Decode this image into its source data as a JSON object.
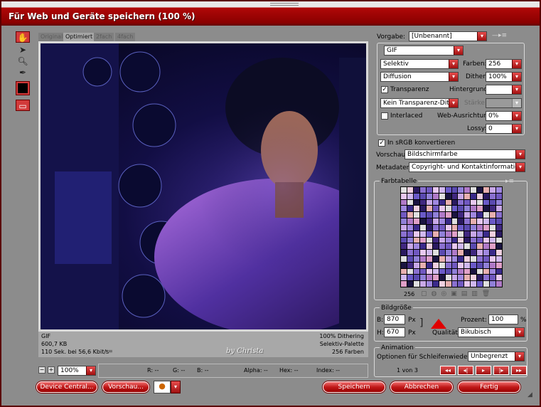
{
  "window": {
    "title": "Für Web und Geräte speichern (100 %)"
  },
  "tabs": [
    "Original",
    "Optimiert",
    "2fach",
    "4fach"
  ],
  "active_tab": 1,
  "tools": [
    "hand-icon",
    "slice-select-icon",
    "zoom-icon",
    "eyedropper-icon",
    "eyedropper-color-swatch",
    "slices-toggle-icon"
  ],
  "image_info": {
    "left": [
      "GIF",
      "600,7 KB",
      "110 Sek. bei 56,6 Kbit/s"
    ],
    "right": [
      "100% Dithering",
      "Selektiv-Palette",
      "256 Farben"
    ],
    "watermark": "by Christa"
  },
  "statusbar": {
    "zoom": "100%",
    "r": "R: --",
    "g": "G: --",
    "b": "B: --",
    "alpha": "Alpha: --",
    "hex": "Hex: --",
    "index": "Index: --"
  },
  "settings": {
    "vorgabe_label": "Vorgabe:",
    "vorgabe_value": "[Unbenannt]",
    "format": "GIF",
    "reduction": "Selektiv",
    "farben_label": "Farben:",
    "farben_value": "256",
    "dither_algo": "Diffusion",
    "dither_label": "Dither:",
    "dither_value": "100%",
    "transparenz_label": "Transparenz",
    "transparenz_checked": true,
    "hintergrund_label": "Hintergrund:",
    "transp_dither": "Kein Transparenz-Dither",
    "staerke_label": "Stärke:",
    "interlaced_label": "Interlaced",
    "interlaced_checked": false,
    "web_label": "Web-Ausrichtung:",
    "web_value": "0%",
    "lossy_label": "Lossy:",
    "lossy_value": "0",
    "srgb_label": "In sRGB konvertieren",
    "srgb_checked": true,
    "vorschau_label": "Vorschau:",
    "vorschau_value": "Bildschirmfarbe",
    "metadaten_label": "Metadaten:",
    "metadaten_value": "Copyright- und Kontaktinformationen"
  },
  "farbtabelle": {
    "title": "Farbtabelle",
    "count": "256",
    "colors": [
      "#3a2a8a",
      "#6a5ac8",
      "#c8a8e8",
      "#e8c8f0",
      "#1a1440",
      "#8a70d0",
      "#b07ac8",
      "#f0d0e0",
      "#5a4ab0",
      "#a088e0",
      "#d0b8f0",
      "#402880",
      "#7058c0",
      "#e0a0c8",
      "#2a1a60",
      "#9080d8"
    ]
  },
  "bildgroesse": {
    "title": "Bildgröße",
    "b_label": "B:",
    "b_value": "870",
    "b_unit": "Px",
    "h_label": "H:",
    "h_value": "670",
    "h_unit": "Px",
    "prozent_label": "Prozent:",
    "prozent_value": "100",
    "prozent_unit": "%",
    "qualitaet_label": "Qualität:",
    "qualitaet_value": "Bikubisch"
  },
  "animation": {
    "title": "Animation",
    "loop_label": "Optionen für Schleifenwiedergabe:",
    "loop_value": "Unbegrenzt",
    "frame_counter": "1 von 3"
  },
  "buttons": {
    "device_central": "Device Central...",
    "vorschau": "Vorschau...",
    "speichern": "Speichern",
    "abbrechen": "Abbrechen",
    "fertig": "Fertig"
  },
  "colors": {
    "accent": "#c01818",
    "panel": "#8c8c8c",
    "title": "#8a0000"
  }
}
